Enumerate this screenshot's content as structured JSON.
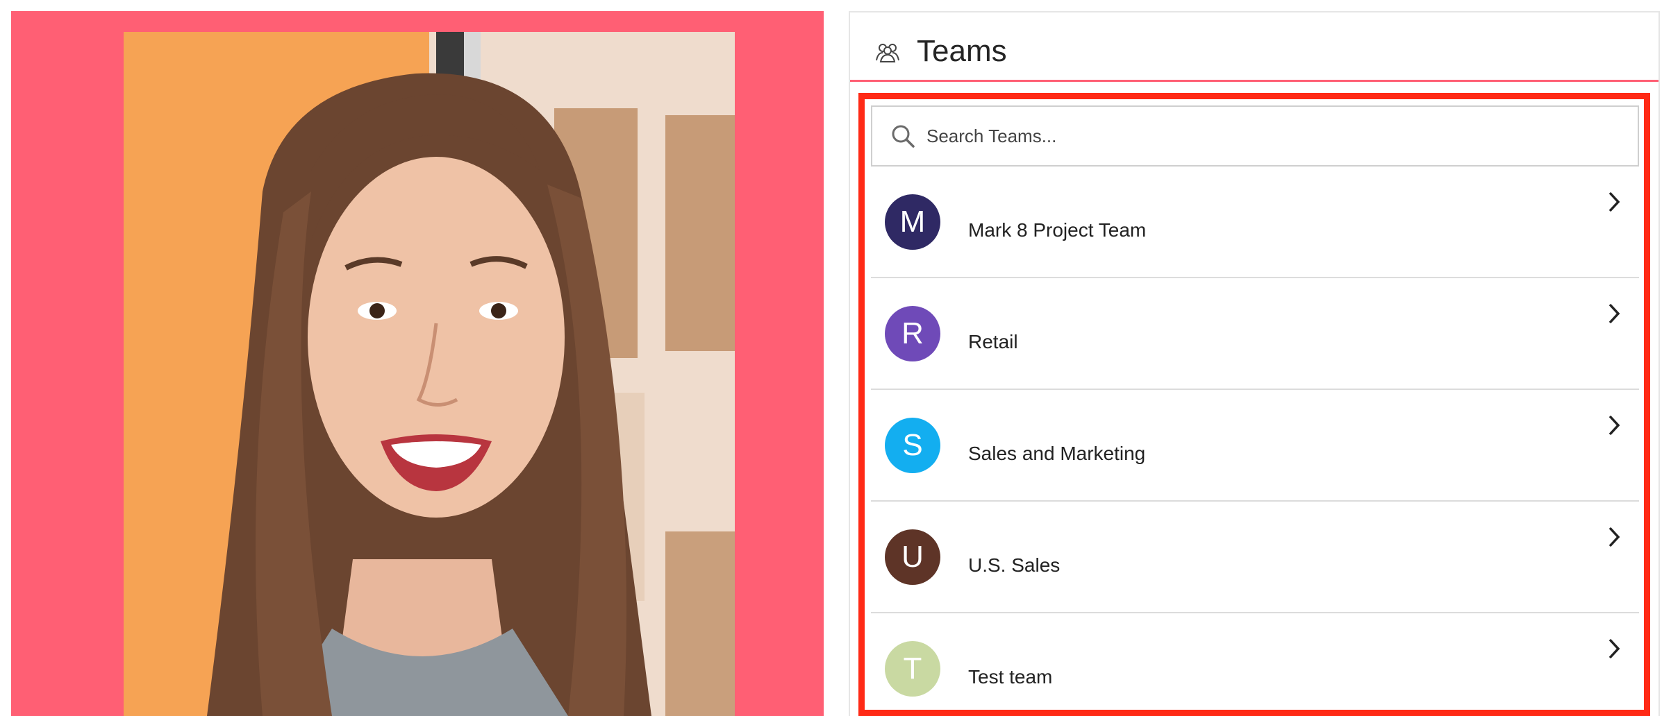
{
  "header": {
    "title": "Teams",
    "icon": "people-group-icon"
  },
  "photo": {
    "description_icon": "profile-photo",
    "panel_color": "#ff5f74"
  },
  "search": {
    "placeholder": "Search Teams...",
    "value": "",
    "icon": "search-icon"
  },
  "teams": [
    {
      "initial": "M",
      "name": "Mark 8 Project Team",
      "color": "#2f2964"
    },
    {
      "initial": "R",
      "name": "Retail",
      "color": "#6f4ab8"
    },
    {
      "initial": "S",
      "name": "Sales and Marketing",
      "color": "#13aef0"
    },
    {
      "initial": "U",
      "name": "U.S. Sales",
      "color": "#5e3427"
    },
    {
      "initial": "T",
      "name": "Test team",
      "color": "#c9d9a2"
    }
  ],
  "colors": {
    "accent": "#ff5f74",
    "highlight": "#ff2a16",
    "divider": "#dcdcdc"
  }
}
